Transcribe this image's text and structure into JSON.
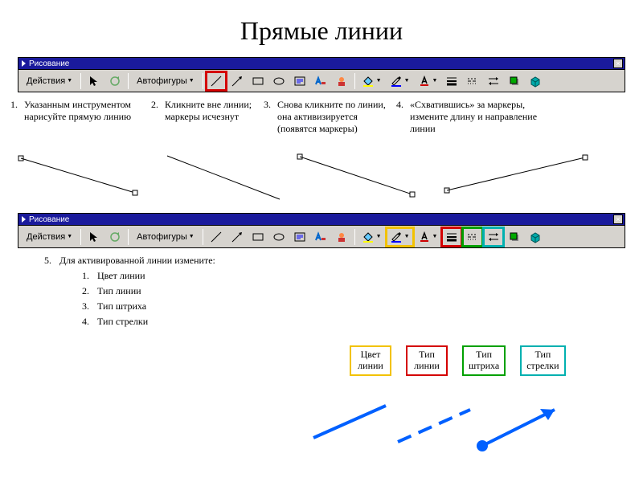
{
  "title": "Прямые линии",
  "toolbar": {
    "caption": "Рисование",
    "actions": "Действия",
    "autoshapes": "Автофигуры",
    "close": "×"
  },
  "steps": {
    "s1": {
      "n": "1.",
      "t": "Указанным инструментом нарисуйте прямую линию"
    },
    "s2": {
      "n": "2.",
      "t": "Кликните вне линии; маркеры исчезнут"
    },
    "s3": {
      "n": "3.",
      "t": "Снова кликните по линии, она активизируется (появятся маркеры)"
    },
    "s4": {
      "n": "4.",
      "t": "«Схватившись» за маркеры, измените длину и направление линии"
    },
    "s5": {
      "n": "5.",
      "t": "Для активированной линии измените:"
    }
  },
  "sub": {
    "a": {
      "n": "1.",
      "t": "Цвет линии"
    },
    "b": {
      "n": "2.",
      "t": "Тип линии"
    },
    "c": {
      "n": "3.",
      "t": "Тип штриха"
    },
    "d": {
      "n": "4.",
      "t": "Тип стрелки"
    }
  },
  "labels": {
    "color": "Цвет\nлинии",
    "type": "Тип\nлинии",
    "dash": "Тип\nштриха",
    "arrow": "Тип\nстрелки"
  }
}
